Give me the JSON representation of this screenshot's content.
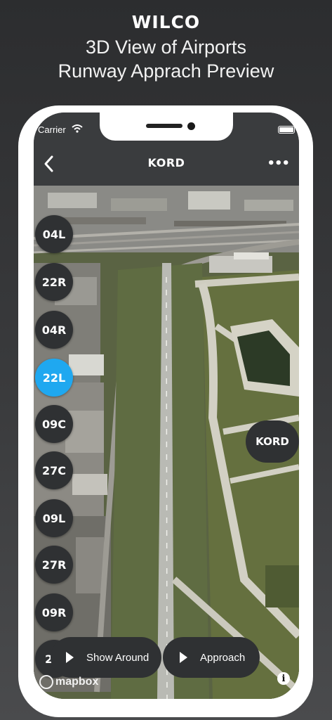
{
  "promo": {
    "title": "WILCO",
    "subtitle_line1": "3D View of Airports",
    "subtitle_line2": "Runway Apprach Preview"
  },
  "status_bar": {
    "carrier": "Carrier",
    "wifi_icon": "wifi-icon",
    "battery_icon": "battery-icon"
  },
  "navbar": {
    "title": "KORD",
    "back_icon": "chevron-left-icon",
    "more_label": "•••"
  },
  "runways": [
    {
      "label": "04L",
      "active": false
    },
    {
      "label": "22R",
      "active": false
    },
    {
      "label": "04R",
      "active": false
    },
    {
      "label": "22L",
      "active": true
    },
    {
      "label": "09C",
      "active": false
    },
    {
      "label": "27C",
      "active": false
    },
    {
      "label": "09L",
      "active": false
    },
    {
      "label": "27R",
      "active": false
    },
    {
      "label": "09R",
      "active": false
    },
    {
      "label": "2",
      "active": false
    }
  ],
  "airport_chip": "KORD",
  "actions": {
    "show_around": "Show Around",
    "approach": "Approach"
  },
  "attribution": {
    "mapbox": "mapbox",
    "info": "i"
  },
  "colors": {
    "accent": "#1fa8f0",
    "button_bg": "#2f3133",
    "bar_bg": "#3a3c3e"
  }
}
